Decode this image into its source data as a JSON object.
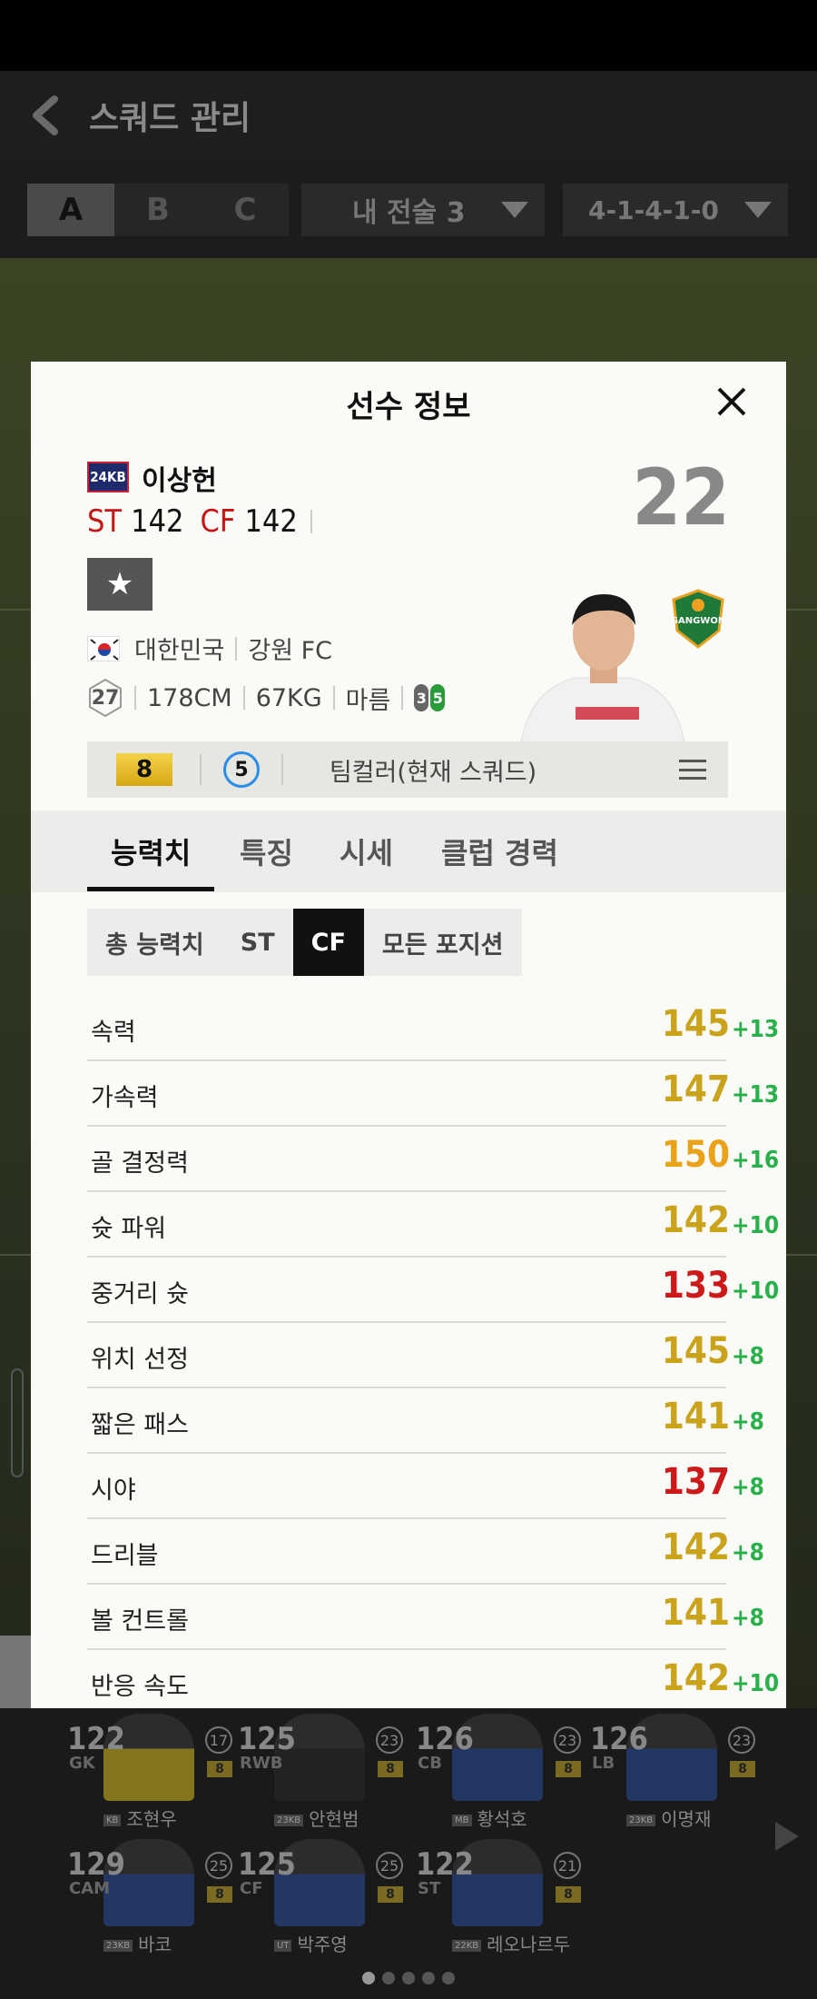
{
  "header": {
    "title": "스쿼드 관리"
  },
  "filters": {
    "squads": [
      "A",
      "B",
      "C"
    ],
    "tactic": "내 전술 3",
    "formation": "4-1-4-1-0"
  },
  "modal": {
    "title": "선수 정보",
    "season_badge": "24KB",
    "player_name": "이상헌",
    "positions": [
      {
        "pos": "ST",
        "ovr": "142"
      },
      {
        "pos": "CF",
        "ovr": "142"
      }
    ],
    "back_number": "22",
    "nationality": "대한민국",
    "club": "강원 FC",
    "age": "27",
    "height": "178CM",
    "weight": "67KG",
    "body_type": "마름",
    "foot_left": "3",
    "foot_right": "5",
    "enhance_level": "8",
    "level_circle": "5",
    "team_color": "팀컬러(현재 스쿼드)",
    "club_emblem_text": "GANGWON",
    "tabs": [
      "능력치",
      "특징",
      "시세",
      "클럽 경력"
    ],
    "subtabs": [
      "총 능력치",
      "ST",
      "CF",
      "모든 포지션"
    ],
    "stats": [
      {
        "label": "속력",
        "value": "145",
        "bonus": "+13",
        "color": "#c9a31b"
      },
      {
        "label": "가속력",
        "value": "147",
        "bonus": "+13",
        "color": "#c9a31b"
      },
      {
        "label": "골 결정력",
        "value": "150",
        "bonus": "+16",
        "color": "#e9a21a"
      },
      {
        "label": "슛 파워",
        "value": "142",
        "bonus": "+10",
        "color": "#c9a31b"
      },
      {
        "label": "중거리 슛",
        "value": "133",
        "bonus": "+10",
        "color": "#cc1a1a"
      },
      {
        "label": "위치 선정",
        "value": "145",
        "bonus": "+8",
        "color": "#c9a31b"
      },
      {
        "label": "짧은 패스",
        "value": "141",
        "bonus": "+8",
        "color": "#c9a31b"
      },
      {
        "label": "시야",
        "value": "137",
        "bonus": "+8",
        "color": "#cc1a1a"
      },
      {
        "label": "드리블",
        "value": "142",
        "bonus": "+8",
        "color": "#c9a31b"
      },
      {
        "label": "볼 컨트롤",
        "value": "141",
        "bonus": "+8",
        "color": "#c9a31b"
      },
      {
        "label": "반응 속도",
        "value": "142",
        "bonus": "+10",
        "color": "#c9a31b"
      }
    ]
  },
  "bench": [
    {
      "ovr": "122",
      "pos": "GK",
      "lv": "17",
      "enh": "8",
      "season": "KB",
      "name": "조현우",
      "kit": "#d8c020"
    },
    {
      "ovr": "125",
      "pos": "RWB",
      "lv": "23",
      "enh": "8",
      "season": "23KB",
      "name": "안현범",
      "kit": "#2a2a2a"
    },
    {
      "ovr": "126",
      "pos": "CB",
      "lv": "23",
      "enh": "8",
      "season": "MB",
      "name": "황석호",
      "kit": "#2b4fa0"
    },
    {
      "ovr": "126",
      "pos": "LB",
      "lv": "23",
      "enh": "8",
      "season": "23KB",
      "name": "이명재",
      "kit": "#2b4fa0"
    },
    {
      "ovr": "129",
      "pos": "CAM",
      "lv": "25",
      "enh": "8",
      "season": "23KB",
      "name": "바코",
      "kit": "#2b4fa0"
    },
    {
      "ovr": "125",
      "pos": "CF",
      "lv": "25",
      "enh": "8",
      "season": "UT",
      "name": "박주영",
      "kit": "#2b4fa0"
    },
    {
      "ovr": "122",
      "pos": "ST",
      "lv": "21",
      "enh": "8",
      "season": "22KB",
      "name": "레오나르두",
      "kit": "#2b4fa0"
    }
  ],
  "colors": {
    "accent_active": "#111111",
    "bonus_green": "#2ab04a",
    "enhance_gold": "#e2b828",
    "level_blue": "#2a8de8"
  }
}
